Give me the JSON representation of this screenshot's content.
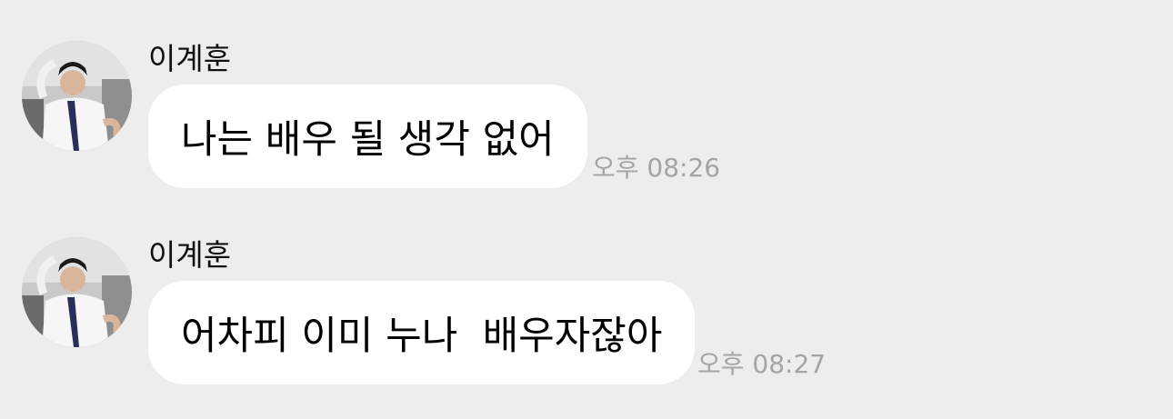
{
  "messages": [
    {
      "sender": "이계훈",
      "text": "나는 배우 될 생각 없어",
      "time": "오후 08:26"
    },
    {
      "sender": "이계훈",
      "text": "어차피 이미 누나  배우자잖아",
      "time": "오후 08:27"
    }
  ],
  "colors": {
    "background": "#ededed",
    "bubble": "#ffffff",
    "time_text": "#a4a4a4"
  }
}
